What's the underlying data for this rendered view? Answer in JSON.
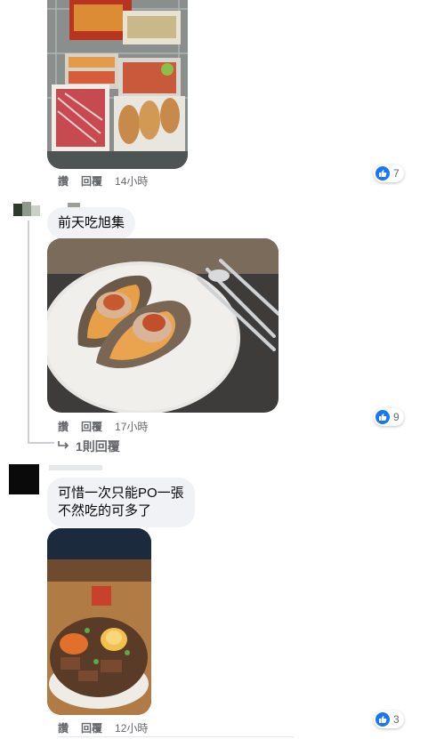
{
  "comments": [
    {
      "text": "",
      "actions": {
        "like": "讚",
        "reply": "回覆",
        "time": "14小時"
      },
      "reactions": "7",
      "image_desc": "shopping-cart-food"
    },
    {
      "text": "前天吃旭集",
      "actions": {
        "like": "讚",
        "reply": "回覆",
        "time": "17小時"
      },
      "reactions": "9",
      "image_desc": "oysters",
      "replies_link": "1則回覆"
    },
    {
      "text_lines": [
        "可惜一次只能PO一張",
        "不然吃的可多了"
      ],
      "actions": {
        "like": "讚",
        "reply": "回覆",
        "time": "12小時"
      },
      "reactions": "3",
      "image_desc": "beef-rice-bowl"
    }
  ],
  "colors": {
    "like_blue": "#1877f2",
    "bubble_bg": "#f0f2f5",
    "meta_gray": "#65676b"
  }
}
